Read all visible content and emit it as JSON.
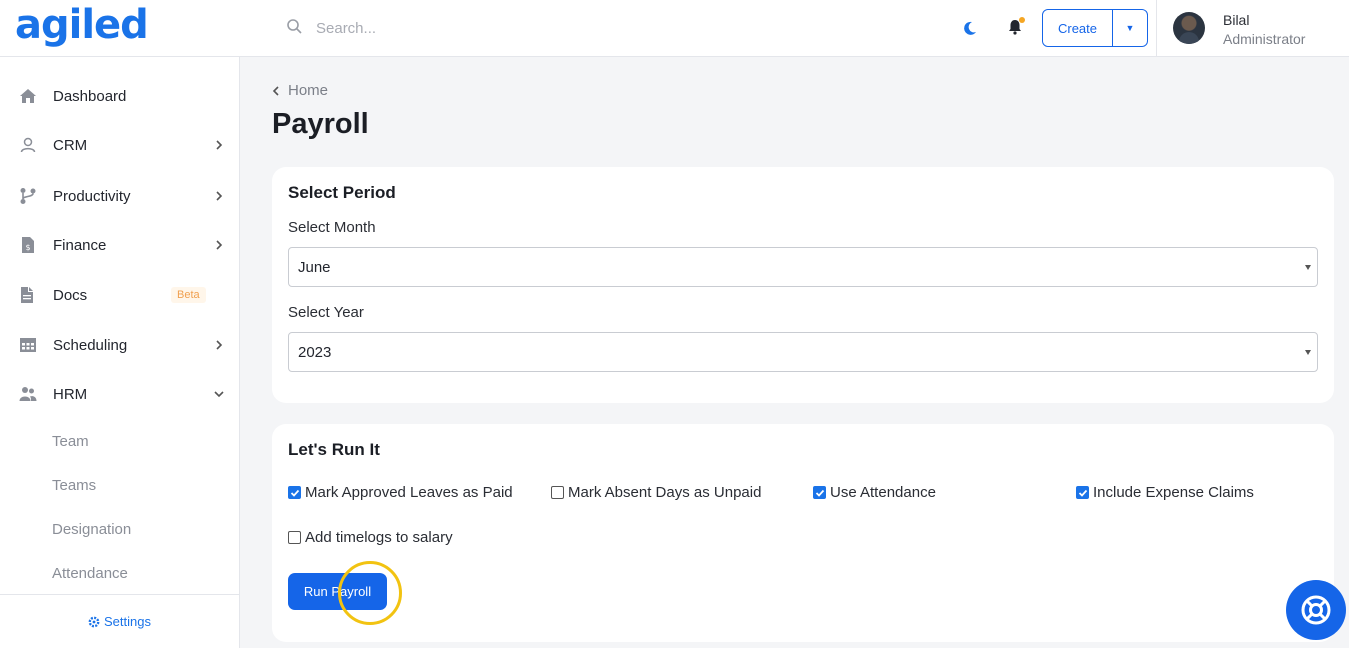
{
  "header": {
    "logo": "agiled",
    "search_placeholder": "Search...",
    "create_label": "Create",
    "user_name": "Bilal",
    "user_role": "Administrator"
  },
  "sidebar": {
    "items": [
      {
        "label": "Dashboard",
        "icon": "home-icon"
      },
      {
        "label": "CRM",
        "icon": "user-icon"
      },
      {
        "label": "Productivity",
        "icon": "branch-icon"
      },
      {
        "label": "Finance",
        "icon": "invoice-icon"
      },
      {
        "label": "Docs",
        "icon": "docs-icon",
        "badge": "Beta"
      },
      {
        "label": "Scheduling",
        "icon": "calendar-icon"
      },
      {
        "label": "HRM",
        "icon": "people-icon"
      }
    ],
    "hrm_subitems": [
      "Team",
      "Teams",
      "Designation",
      "Attendance"
    ],
    "settings_label": "Settings"
  },
  "breadcrumb": {
    "label": "Home"
  },
  "page_title": "Payroll",
  "select_period": {
    "title": "Select Period",
    "month_label": "Select Month",
    "month_value": "June",
    "year_label": "Select Year",
    "year_value": "2023"
  },
  "run_section": {
    "title": "Let's Run It",
    "options": [
      {
        "label": "Mark Approved Leaves as Paid",
        "checked": true
      },
      {
        "label": "Mark Absent Days as Unpaid",
        "checked": false
      },
      {
        "label": "Use Attendance",
        "checked": true
      },
      {
        "label": "Include Expense Claims",
        "checked": true
      },
      {
        "label": "Add timelogs to salary",
        "checked": false
      }
    ],
    "run_button": "Run Payroll"
  },
  "colors": {
    "accent": "#1565e8",
    "highlight": "#f2c311",
    "badge": "#f0a050"
  }
}
